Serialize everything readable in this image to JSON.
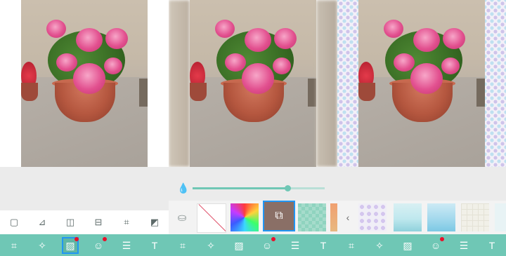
{
  "panels": [
    {
      "id": "crop-view",
      "tool_row": [
        "square-icon",
        "ratio-icon",
        "flip-horizontal-icon",
        "flip-vertical-icon",
        "crop-icon",
        "aspect-icon"
      ],
      "bottom_bar": [
        "crop-icon",
        "magic-wand-icon",
        "background-icon",
        "sticker-icon",
        "adjust-icon",
        "text-icon"
      ],
      "selected_tool": "background-icon"
    },
    {
      "id": "blur-background",
      "opacity_slider": {
        "value": 0.72
      },
      "backgrounds": [
        "store-icon",
        "none",
        "color-picker",
        "photo-background",
        "pixel-pattern"
      ],
      "selected_background": "photo-background",
      "bottom_bar": [
        "crop-icon",
        "magic-wand-icon",
        "background-icon",
        "sticker-icon",
        "adjust-icon",
        "text-icon"
      ]
    },
    {
      "id": "pattern-background",
      "patterns": [
        "dots-pattern",
        "cloud-pattern",
        "sky-pattern",
        "grid-pattern"
      ],
      "bottom_bar": [
        "crop-icon",
        "magic-wand-icon",
        "background-icon",
        "sticker-icon",
        "adjust-icon",
        "text-icon"
      ]
    }
  ],
  "colors": {
    "accent": "#6fc7b5",
    "selection": "#2196f3",
    "badge": "#e8102a"
  }
}
